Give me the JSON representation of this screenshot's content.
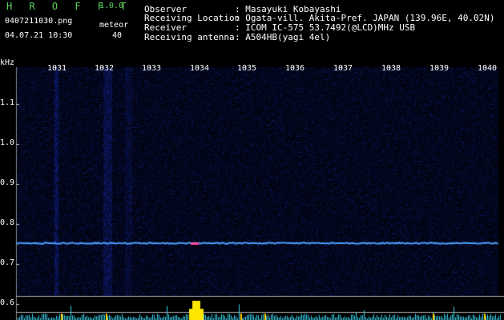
{
  "header": {
    "app_name": "H R O F F T",
    "version": "1.0.0",
    "filename": "0407211030.png",
    "datetime": "04.07.21 10:30",
    "meteor_label": "meteor",
    "meteor_count": "40"
  },
  "info": {
    "observer_label": "Observer",
    "observer_value": ": Masayuki Kobayashi",
    "location_label": "Receiving Location",
    "location_value": ": Ogata-vill. Akita-Pref. JAPAN (139.96E, 40.02N)",
    "receiver_label": "Receiver",
    "receiver_value": ": ICOM IC-575 53.7492(@LCD)MHz USB",
    "antenna_label": "Receiving antenna",
    "antenna_value": ": A504HB(yagi 4el)"
  },
  "axes": {
    "y_unit": "kHz",
    "y_ticks": [
      "1.1",
      "1.0",
      "0.9",
      "0.8",
      "0.7",
      "0.6"
    ],
    "x_ticks": [
      "1031",
      "1032",
      "1033",
      "1034",
      "1035",
      "1036",
      "1037",
      "1038",
      "1039",
      "1040"
    ]
  },
  "colors": {
    "title_green": "#5fd35f",
    "spectrum_blue": "#1a2a8a",
    "carrier_blue": "#4aa0ff",
    "level_cyan": "#3ad6f0",
    "level_yellow": "#ffe600"
  }
}
